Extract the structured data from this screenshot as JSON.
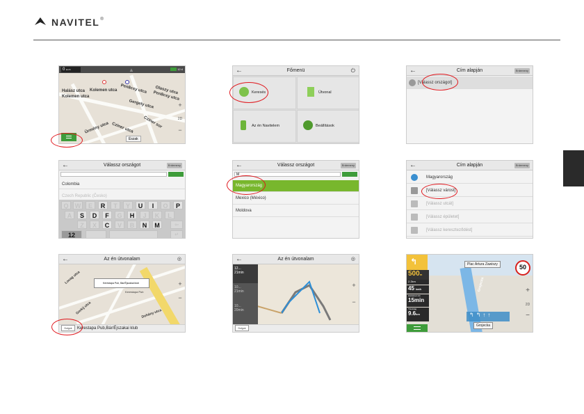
{
  "brand": {
    "name": "NAVITEL",
    "reg": "®"
  },
  "s1": {
    "speed": "0",
    "speed_unit": "km/h",
    "battery": "12:4",
    "streets": [
      "Ybl Miklós",
      "Halász utca",
      "Kolemen utca",
      "Kolemen utca",
      "Pen8csy utca",
      "Olaszy utca",
      "Pen8csy utca",
      "Gergely utca",
      "Ürmény utca",
      "Cziner sor",
      "Cziner utca"
    ],
    "north": "Észak",
    "compass": "2D"
  },
  "s2": {
    "title": "Főmenü",
    "tiles": [
      "Keresés",
      "Útvonal",
      "Az én Navitelem",
      "Beállítások"
    ]
  },
  "s3": {
    "title": "Cím alapján",
    "right_btn": "Erdemeny",
    "row": "[Válassz országot]"
  },
  "s4": {
    "title": "Válassz országot",
    "right_btn": "Erdemeny",
    "rows": [
      "Colombia",
      "Czech Republic (Česko)"
    ],
    "keys": [
      "Q",
      "W",
      "E",
      "R",
      "T",
      "Y",
      "U",
      "I",
      "O",
      "P",
      "A",
      "S",
      "D",
      "F",
      "G",
      "H",
      "J",
      "K",
      "L",
      "Z",
      "X",
      "C",
      "V",
      "B",
      "N",
      "M"
    ],
    "active_keys": [
      "R",
      "U",
      "I",
      "P",
      "S",
      "D",
      "F",
      "H",
      "C",
      "N",
      "M"
    ],
    "num_key": "12"
  },
  "s5": {
    "title": "Válassz országot",
    "right_btn": "Erdemeny",
    "input": "M",
    "rows": [
      "Magyarország",
      "Mexico (México)",
      "Moldova"
    ]
  },
  "s6": {
    "title": "Cím alapján",
    "right_btn": "Erdemeny",
    "rows": [
      "Magyarország",
      "[Válassz várost]",
      "[Válassz utcát]",
      "[Válassz épületet]",
      "[Válassz kereszteződést]"
    ]
  },
  "s7": {
    "title": "Az én útvonalam",
    "poi": "Kerestapa Pub, Bár/Éjszakai klub",
    "poi_short": "Kerestapa Pub",
    "streets": [
      "Lovag utca",
      "Gorkij utca",
      "Dohány utca"
    ],
    "bottom_btn": "Dolgok",
    "bottom_text": "Kerestapa Pub,Bár/Éjszakai klub"
  },
  "s8": {
    "title": "Az én útvonalam",
    "routes": [
      {
        "dist": "12...",
        "time": "21min"
      },
      {
        "dist": "10...",
        "time": "21min"
      },
      {
        "dist": "10...",
        "time": "20min"
      }
    ],
    "bottom_btn": "Dolgok"
  },
  "s9": {
    "street": "Plac Artura Zawiszy",
    "dist": "500",
    "dist_unit": "m",
    "speed_small": "2.2km",
    "speed_now": "45",
    "speed_unit": "km/h",
    "time_label": "Hátralévő idő",
    "time": "15min",
    "dist_label": "Távolság",
    "remaining": "9.6",
    "remaining_unit": "km",
    "next": "Grojecka",
    "limit": "50",
    "road": "Grojecka",
    "mode": "2D"
  }
}
